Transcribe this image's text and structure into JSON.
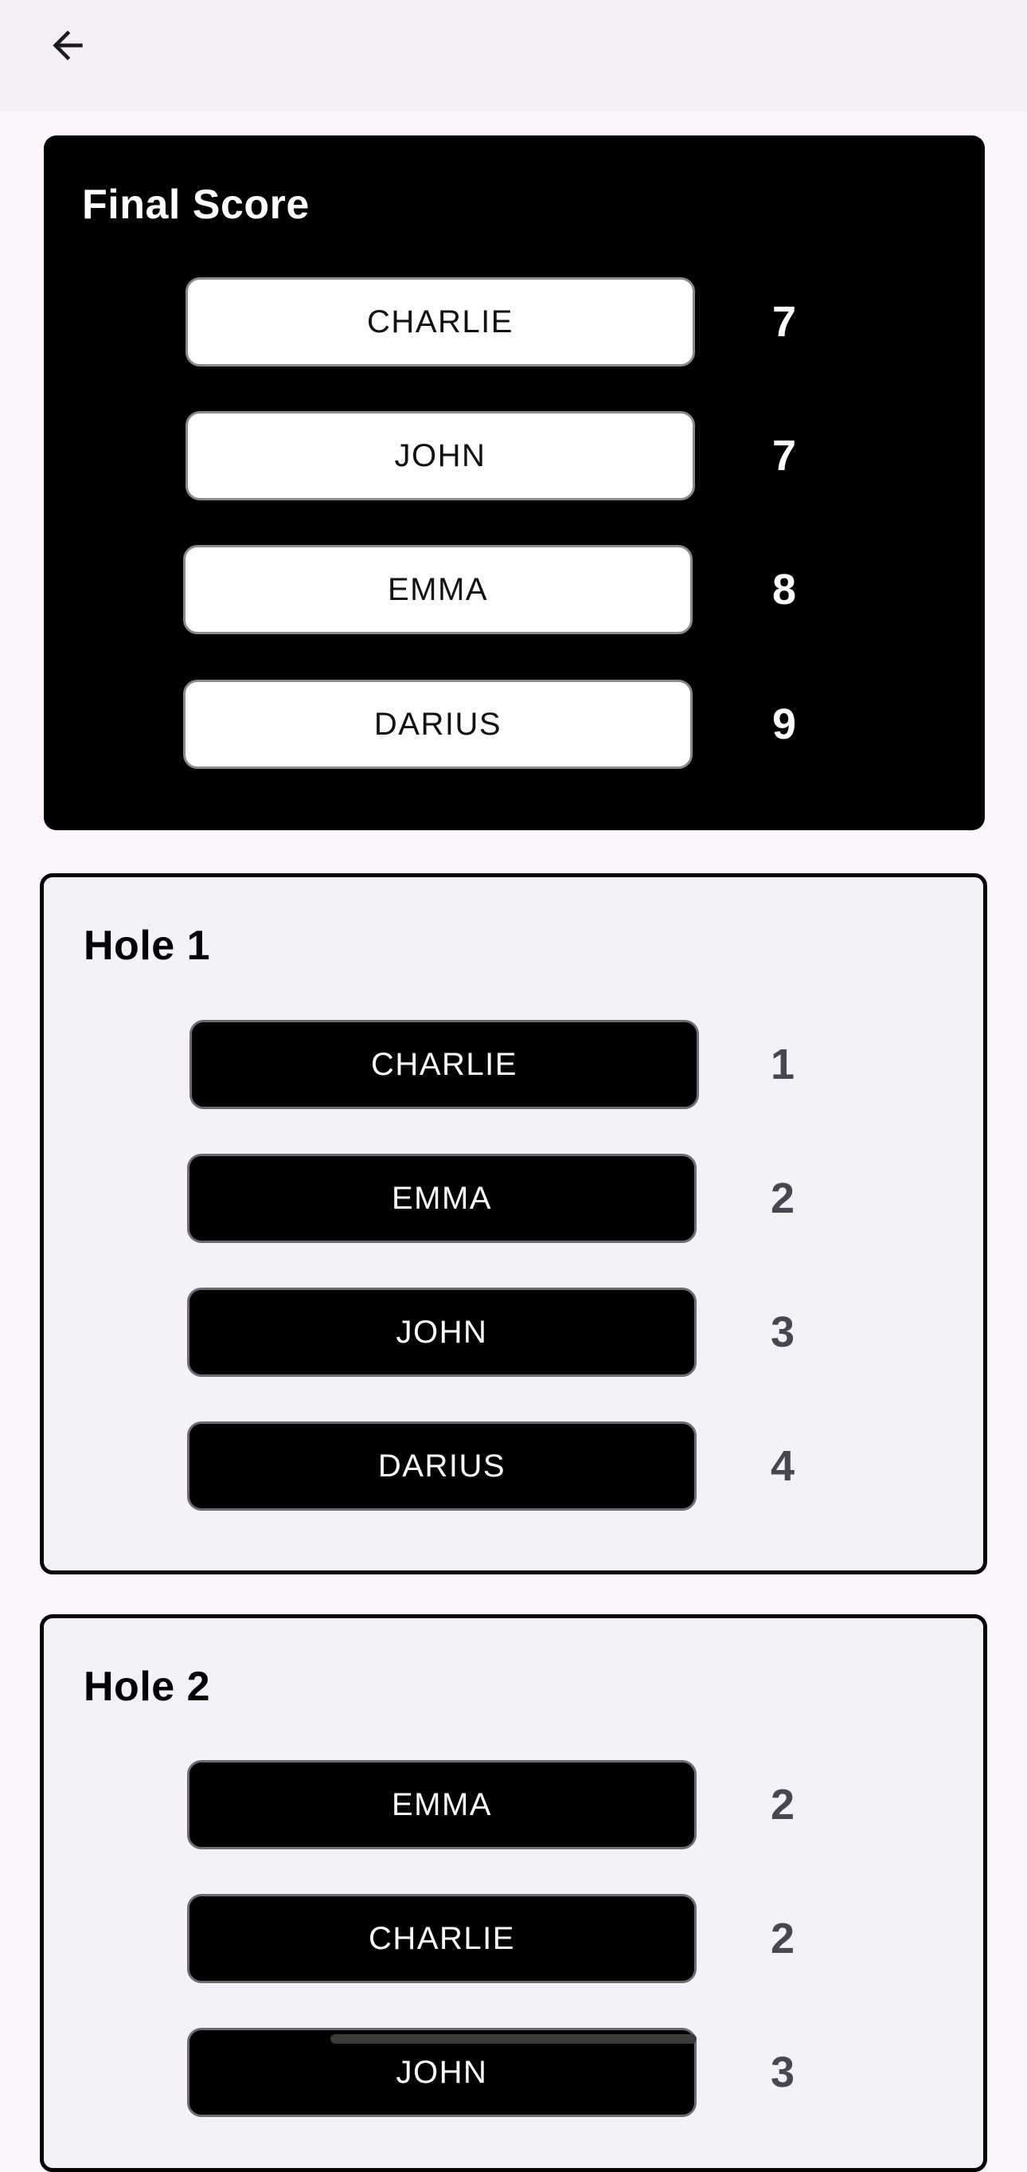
{
  "header": {
    "back_icon": "arrow-left-icon"
  },
  "final_score": {
    "title": "Final Score",
    "rows": [
      {
        "name": "CHARLIE",
        "score": "7"
      },
      {
        "name": "JOHN",
        "score": "7"
      },
      {
        "name": "EMMA",
        "score": "8"
      },
      {
        "name": "DARIUS",
        "score": "9"
      }
    ]
  },
  "holes": [
    {
      "title": "Hole 1",
      "rows": [
        {
          "name": "CHARLIE",
          "score": "1"
        },
        {
          "name": "EMMA",
          "score": "2"
        },
        {
          "name": "JOHN",
          "score": "3"
        },
        {
          "name": "DARIUS",
          "score": "4"
        }
      ]
    },
    {
      "title": "Hole 2",
      "rows": [
        {
          "name": "EMMA",
          "score": "2"
        },
        {
          "name": "CHARLIE",
          "score": "2"
        },
        {
          "name": "JOHN",
          "score": "3"
        }
      ]
    }
  ],
  "colors": {
    "final_card_bg": "#000000",
    "hole_card_bg": "#f4f1f8",
    "page_bg": "#fdf7fd"
  }
}
